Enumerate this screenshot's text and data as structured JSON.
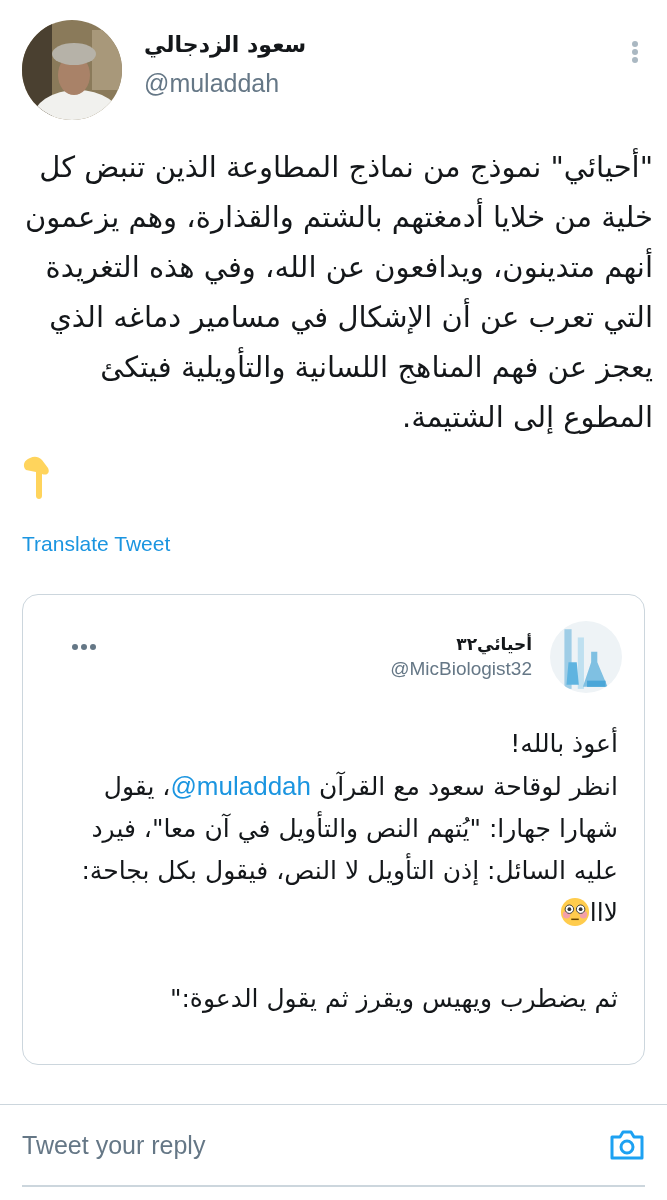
{
  "tweet": {
    "author": {
      "name": "سعود الزدجالي",
      "handle": "@muladdah"
    },
    "text": "\"أحيائي\" نموذج من نماذج المطاوعة الذين تنبض كل خلية من خلايا أدمغتهم بالشتم والقذارة، وهم يزعمون أنهم متدينون، ويدافعون عن الله، وفي هذه التغريدة التي تعرب عن أن الإشكال في مسامير دماغه الذي يعجز عن فهم المناهج اللسانية والتأويلية فيتكئ المطوع إلى الشتيمة.",
    "translate": "Translate Tweet",
    "quoted": {
      "author": {
        "name": "أحيائي٣٢",
        "handle": "@MicBiologist32"
      },
      "paragraphs": [
        {
          "segments": [
            {
              "kind": "text",
              "text": "أعوذ بالله!"
            }
          ]
        },
        {
          "segments": [
            {
              "kind": "text",
              "text": "انظر لوقاحة سعود مع القرآن "
            },
            {
              "kind": "mention",
              "text": "@muladdah"
            },
            {
              "kind": "text",
              "text": "، يقول شهارا جهارا: \"يُتهم النص والتأويل في آن معا\"، فيرد عليه السائل: إذن التأويل لا النص، فيقول بكل بجاحة: لاﺍﺍ"
            },
            {
              "kind": "emoji"
            }
          ]
        },
        {
          "segments": [
            {
              "kind": "text",
              "text": "ثم يضطرب ويهيس ويقرز ثم يقول الدعوة:\""
            }
          ]
        }
      ]
    }
  },
  "reply": {
    "placeholder": "Tweet your reply"
  }
}
